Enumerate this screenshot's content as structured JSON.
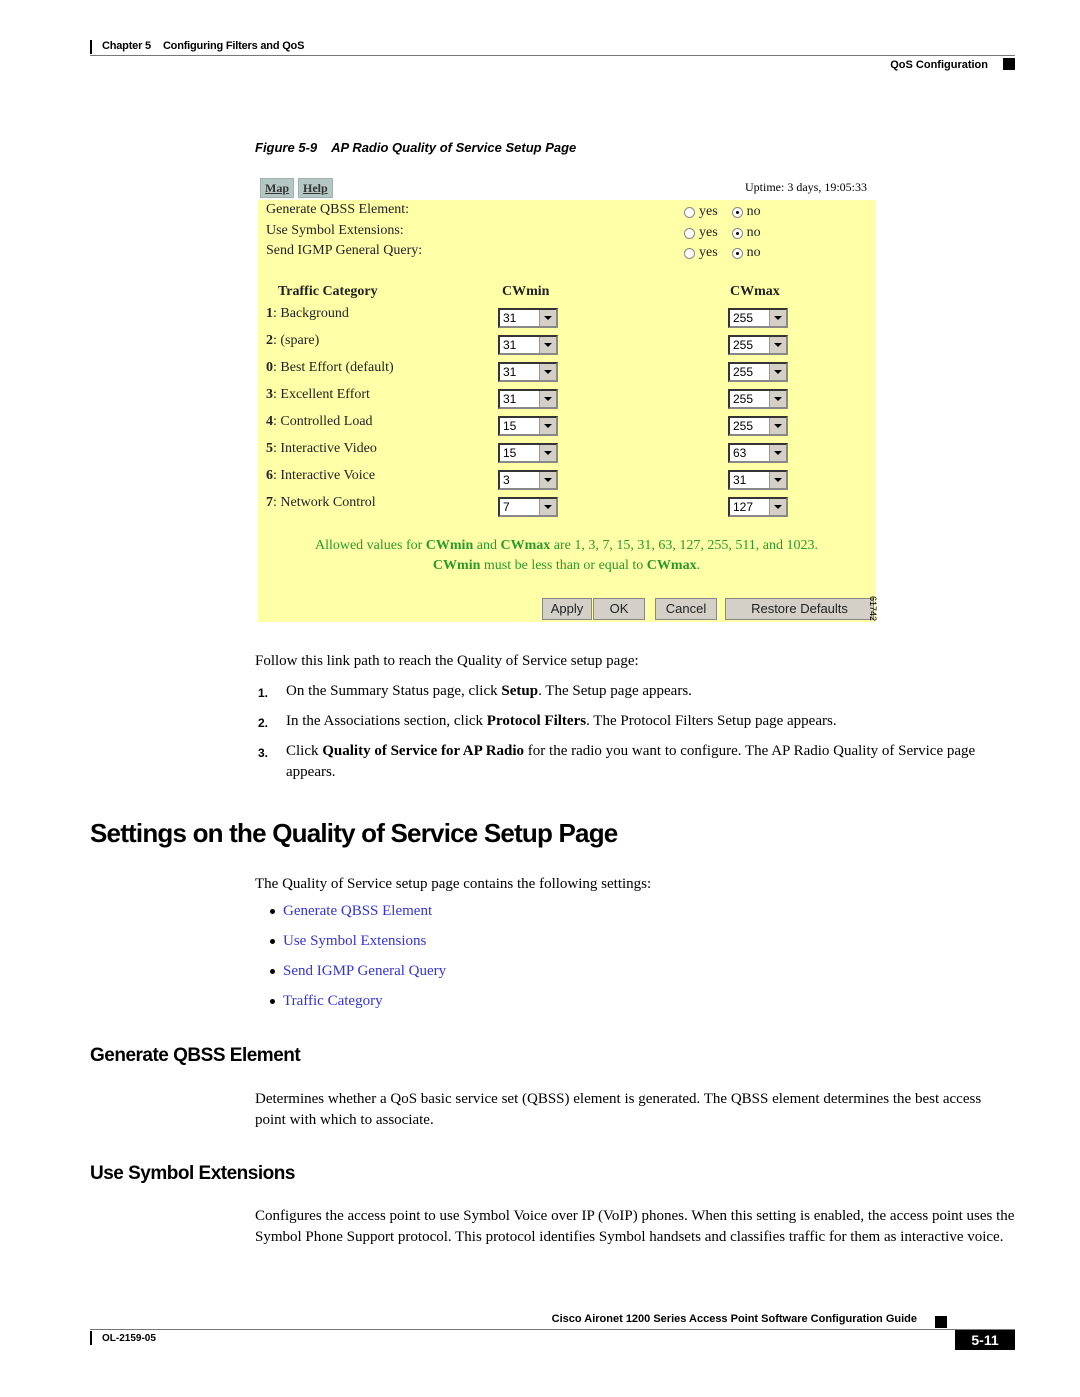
{
  "header": {
    "chapter": "Chapter 5",
    "chapter_title": "Configuring Filters and QoS",
    "section": "QoS Configuration"
  },
  "figure": {
    "number": "Figure 5-9",
    "title": "AP Radio Quality of Service Setup Page",
    "id": "61742",
    "nav": [
      "Map",
      "Help"
    ],
    "uptime": "Uptime: 3 days, 19:05:33",
    "options": [
      {
        "label": "Generate QBSS Element:",
        "yes": "yes",
        "no": "no",
        "selected": "no"
      },
      {
        "label": "Use Symbol Extensions:",
        "yes": "yes",
        "no": "no",
        "selected": "no"
      },
      {
        "label": "Send IGMP General Query:",
        "yes": "yes",
        "no": "no",
        "selected": "no"
      }
    ],
    "table_headers": {
      "category": "Traffic Category",
      "cwmin": "CWmin",
      "cwmax": "CWmax"
    },
    "categories": [
      {
        "num": "1",
        "name": ": Background",
        "cwmin": "31",
        "cwmax": "255"
      },
      {
        "num": "2",
        "name": ": (spare)",
        "cwmin": "31",
        "cwmax": "255"
      },
      {
        "num": "0",
        "name": ": Best Effort (default)",
        "cwmin": "31",
        "cwmax": "255"
      },
      {
        "num": "3",
        "name": ": Excellent Effort",
        "cwmin": "31",
        "cwmax": "255"
      },
      {
        "num": "4",
        "name": ": Controlled Load",
        "cwmin": "15",
        "cwmax": "255"
      },
      {
        "num": "5",
        "name": ": Interactive Video",
        "cwmin": "15",
        "cwmax": "63"
      },
      {
        "num": "6",
        "name": ": Interactive Voice",
        "cwmin": "3",
        "cwmax": "31"
      },
      {
        "num": "7",
        "name": ": Network Control",
        "cwmin": "7",
        "cwmax": "127"
      }
    ],
    "note1": {
      "a": "Allowed values for ",
      "b": "CWmin",
      "c": " and ",
      "d": "CWmax",
      "e": " are 1, 3, 7, 15, 31, 63, 127, 255, 511, and 1023."
    },
    "note2": {
      "a": "CWmin",
      "b": " must be less than or equal to ",
      "c": "CWmax",
      "d": "."
    },
    "buttons": {
      "apply": "Apply",
      "ok": "OK",
      "cancel": "Cancel",
      "restore": "Restore Defaults"
    },
    "note_color": "#2a9a2a",
    "panel_color": "#ffffa8"
  },
  "intro": "Follow this link path to reach the Quality of Service setup page:",
  "steps": [
    {
      "n": "1.",
      "a": "On the Summary Status page, click ",
      "b": "Setup",
      "c": ". The Setup page appears."
    },
    {
      "n": "2.",
      "a": "In the Associations section, click ",
      "b": "Protocol Filters",
      "c": ". The Protocol Filters Setup page appears."
    },
    {
      "n": "3.",
      "a": "Click ",
      "b": "Quality of Service for AP Radio",
      "c": " for the radio you want to configure. The AP Radio Quality of Service page appears."
    }
  ],
  "section": {
    "title": "Settings on the Quality of Service Setup Page",
    "intro": "The Quality of Service setup page contains the following settings:",
    "links": [
      "Generate QBSS Element",
      "Use Symbol Extensions",
      "Send IGMP General Query",
      "Traffic Category"
    ],
    "link_color": "#3333dd"
  },
  "sub1": {
    "title": "Generate QBSS Element",
    "text": "Determines whether a QoS basic service set (QBSS) element is generated. The QBSS element determines the best access point with which to associate."
  },
  "sub2": {
    "title": "Use Symbol Extensions",
    "text": "Configures the access point to use Symbol Voice over IP (VoIP) phones. When this setting is enabled, the access point uses the Symbol Phone Support protocol. This protocol identifies Symbol handsets and classifies traffic for them as interactive voice."
  },
  "footer": {
    "title": "Cisco Aironet 1200 Series Access Point Software Configuration Guide",
    "doc": "OL-2159-05",
    "page": "5-11"
  }
}
